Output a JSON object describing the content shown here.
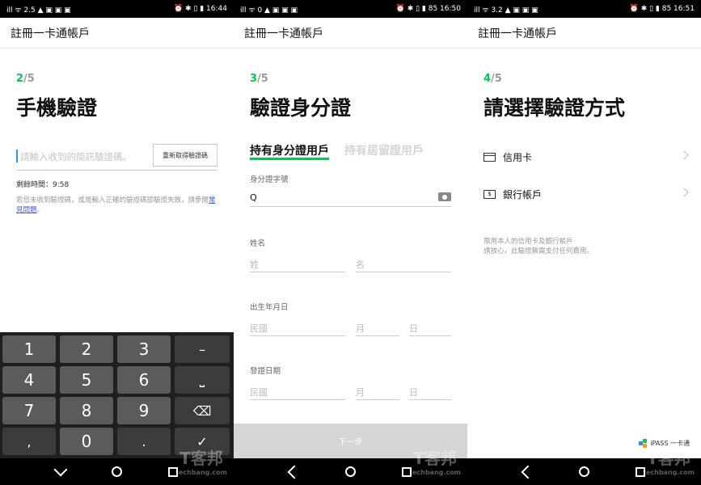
{
  "screens": [
    {
      "status": {
        "left": "ill ᯤ 2.5 ▲ ▣ ▣ ▣",
        "right": "⏰ ✱ ▯ ▮ 16:44"
      },
      "appbar_title": "註冊一卡通帳戶",
      "step_current": "2",
      "step_total": "/5",
      "title": "手機驗證",
      "code_placeholder": "請輸入收到的簡訊驗證碼。",
      "resend_label": "重新取得驗證碼",
      "remaining": "剩餘時間：9:58",
      "help_text": "若您未收到驗證碼，或是輸入正確的驗證碼卻驗證失敗，請參閱",
      "help_link": "常見問題",
      "help_end": "。",
      "keypad": [
        "1",
        "2",
        "3",
        "–",
        "4",
        "5",
        "6",
        "⎵",
        "7",
        "8",
        "9",
        "⌫",
        ",",
        "0",
        ".",
        "✓"
      ],
      "watermark": "T客邦",
      "watermark_sub": "techbang.com"
    },
    {
      "status": {
        "left": "ill ᯤ 0 ▲ ▣ ▣ ▣",
        "right": "⏰ ✱ ▯ ▮ 85 16:50"
      },
      "appbar_title": "註冊一卡通帳戶",
      "step_current": "3",
      "step_total": "/5",
      "title": "驗證身分證",
      "tab_active": "持有身分證用戶",
      "tab_inactive": "持有居留證用戶",
      "id_label": "身分證字號",
      "id_value": "Q",
      "name_label": "姓名",
      "surname_ph": "姓",
      "given_ph": "名",
      "birth_label": "出生年月日",
      "era_ph": "民國",
      "month_ph": "月",
      "day_ph": "日",
      "issue_label": "發證日期",
      "next_label": "下一步",
      "watermark": "T客邦",
      "watermark_sub": "techbang.com"
    },
    {
      "status": {
        "left": "ill ᯤ 3.2 ▲ ▣ ▣ ▣",
        "right": "⏰ ✱ ▯ ▮ 85 16:51"
      },
      "appbar_title": "註冊一卡通帳戶",
      "step_current": "4",
      "step_total": "/5",
      "title": "請選擇驗證方式",
      "options": [
        {
          "label": "信用卡",
          "icon": "credit-card-icon"
        },
        {
          "label": "銀行帳戶",
          "icon": "bank-icon"
        }
      ],
      "note_line1": "限用本人的信用卡及銀行帳戶",
      "note_line2": "請放心，此驗證無需支付任何費用。",
      "brand": "iPASS 一卡通",
      "watermark": "T客邦",
      "watermark_sub": "techbang.com"
    }
  ],
  "colors": {
    "accent": "#06c755",
    "link": "#4a5be0",
    "disabled": "#d5d5d5"
  }
}
